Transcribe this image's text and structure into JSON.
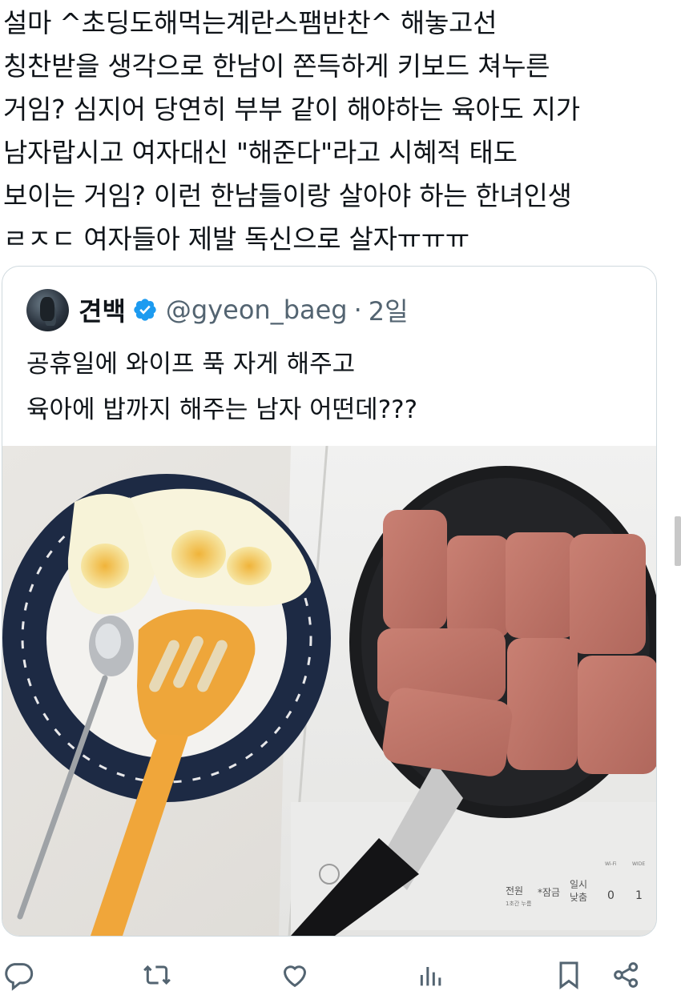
{
  "tweet": {
    "lines": [
      "설마 ^초딩도해먹는계란스팸반찬^ 해놓고선",
      "칭찬받을 생각으로 한남이 쫀득하게 키보드 쳐누른",
      "거임? 심지어 당연히 부부 같이 해야하는 육아도 지가",
      "남자랍시고 여자대신 \"해준다\"라고 시혜적 태도",
      "보이는 거임? 이런 한남들이랑 살아야 하는 한녀인생",
      "ㄹㅈㄷ 여자들아 제발 독신으로 살자ㅠㅠㅠ"
    ]
  },
  "quote": {
    "display_name": "견백",
    "handle": "@gyeon_baeg",
    "separator": "·",
    "time": "2일",
    "text_lines": [
      "공휴일에 와이프 푹 자게 해주고",
      "육아에 밥까지 해주는 남자 어떤데???"
    ],
    "photo_alt": "Fried eggs on a plate next to spam slices frying in a pan",
    "stove_labels": {
      "power": "전원",
      "lock": "*잠금",
      "pause": "일시",
      "pause2": "낮춤",
      "lock_sub": "1초간 누름",
      "left_num": "0",
      "right_num": "1",
      "wifi": "Wi-Fi",
      "wide": "WIDE"
    }
  },
  "actions": {
    "reply": "reply-icon",
    "retweet": "retweet-icon",
    "like": "like-icon",
    "views": "views-icon",
    "bookmark": "bookmark-icon",
    "share": "share-icon"
  },
  "colors": {
    "verified": "#1d9bf0",
    "icon_gray": "#536471",
    "border": "#cfd9de"
  }
}
